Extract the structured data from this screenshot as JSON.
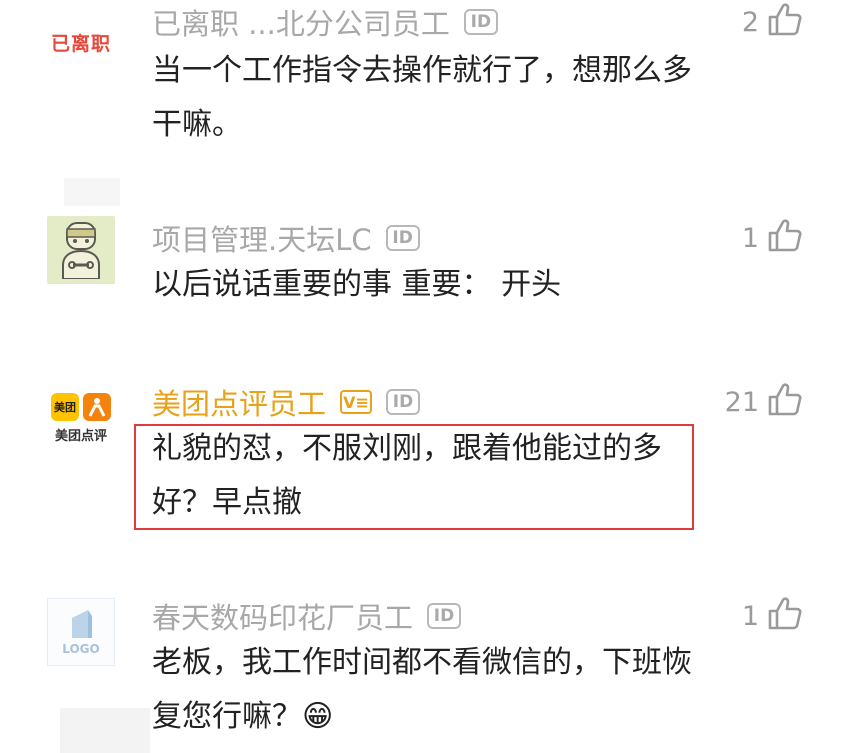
{
  "comments": [
    {
      "avatar_text": "已离职",
      "name": "已离职  ...北分公司员工",
      "id_badge": "ID",
      "text": "当一个工作指令去操作就行了，想那么多干嘛。",
      "likes": "2"
    },
    {
      "avatar_text": "",
      "name": "项目管理.天坛LC",
      "id_badge": "ID",
      "text": "以后说话重要的事 重要： 开头",
      "likes": "1"
    },
    {
      "avatar_text": "美团",
      "avatar_caption": "美团点评",
      "name": "美团点评员工",
      "v_badge": "V≡",
      "id_badge": "ID",
      "text": "礼貌的怼，不服刘刚，跟着他能过的多好？早点撤",
      "likes": "21"
    },
    {
      "avatar_text": "LOGO",
      "name": "春天数码印花厂员工",
      "id_badge": "ID",
      "text": "老板，我工作时间都不看微信的，下班恢复您行嘛？",
      "emoji": "😁",
      "likes": "1"
    }
  ],
  "colors": {
    "meituan_yellow": "#ffc300",
    "meituan_orange": "#f5820c",
    "highlight_red": "#e0393e",
    "resigned_red": "#e8473b",
    "name_gray": "#a8a8a8"
  }
}
